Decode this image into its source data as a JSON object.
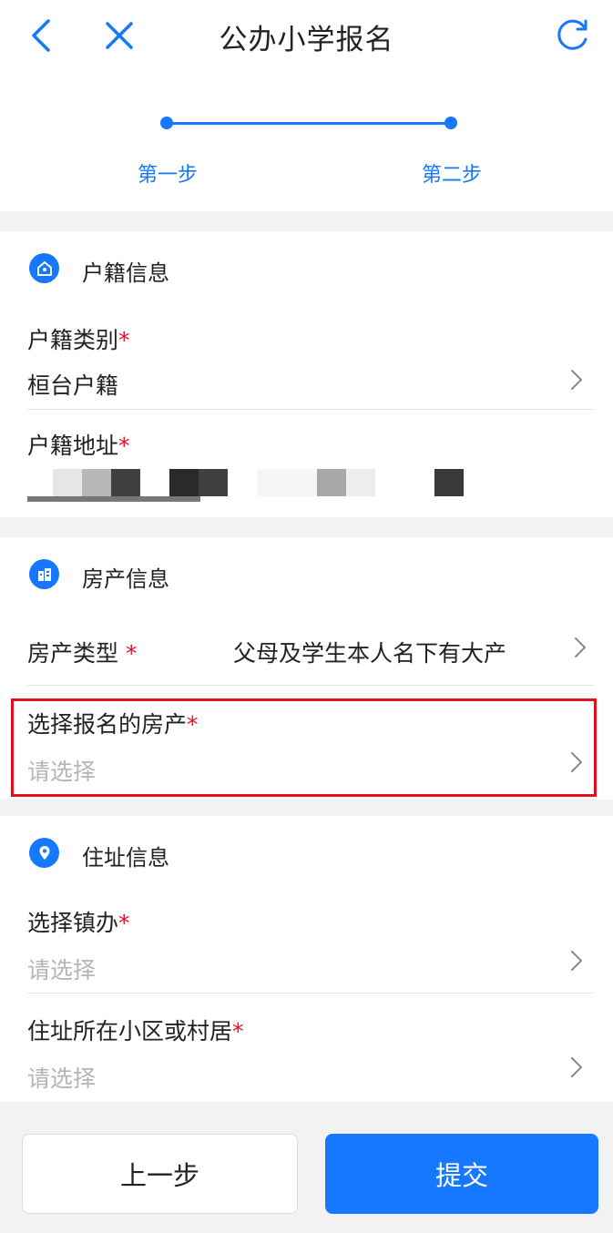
{
  "nav": {
    "back_icon": "chevron-left-icon",
    "close_icon": "close-icon",
    "title": "公办小学报名",
    "refresh_icon": "refresh-icon"
  },
  "steps": {
    "step1": "第一步",
    "step2": "第二步",
    "accent": "#1677ff"
  },
  "huji": {
    "title": "户籍信息",
    "icon": "home-icon",
    "type_label": "户籍类别",
    "type_value": "桓台户籍",
    "address_label": "户籍地址",
    "required_mark": "*"
  },
  "fangchan": {
    "title": "房产信息",
    "icon": "building-icon",
    "type_label": "房产类型",
    "type_value": "父母及学生本人名下有大产",
    "select_label": "选择报名的房产",
    "select_placeholder": "请选择",
    "required_mark": "*"
  },
  "zhuzhi": {
    "title": "住址信息",
    "icon": "map-pin-icon",
    "town_label": "选择镇办",
    "town_placeholder": "请选择",
    "community_label": "住址所在小区或村居",
    "community_placeholder": "请选择",
    "required_mark": "*"
  },
  "footer": {
    "prev_label": "上一步",
    "submit_label": "提交"
  },
  "colors": {
    "primary": "#1677ff",
    "required": "#e0102c",
    "highlight_border": "#e3101f",
    "placeholder": "#b5b5b5"
  }
}
